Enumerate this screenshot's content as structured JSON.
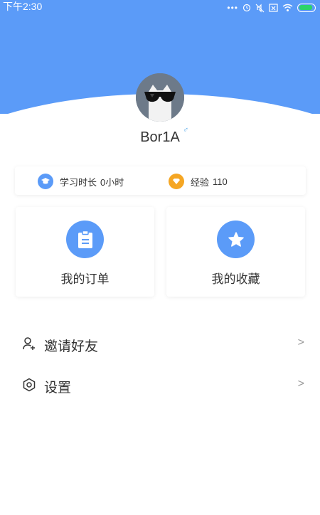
{
  "status_bar": {
    "time": "下午2:30",
    "icons": [
      "more-dots-icon",
      "alarm-icon",
      "mute-icon",
      "sim-icon",
      "wifi-icon",
      "battery-icon"
    ]
  },
  "profile": {
    "username": "Bor1A",
    "gender_symbol": "♂",
    "avatar_icon": "cat-with-sunglasses-avatar"
  },
  "stats": {
    "study_time_label": "学习时长",
    "study_time_value": "0小时",
    "experience_label": "经验",
    "experience_value": "110"
  },
  "cards": [
    {
      "label": "我的订单",
      "icon": "clipboard-icon"
    },
    {
      "label": "我的收藏",
      "icon": "star-icon"
    }
  ],
  "menu": [
    {
      "label": "邀请好友",
      "icon": "add-user-icon",
      "chevron": ">"
    },
    {
      "label": "设置",
      "icon": "hexagon-settings-icon",
      "chevron": ">"
    }
  ],
  "colors": {
    "primary": "#5b9bf8",
    "experience_badge": "#f5a623",
    "text": "#333333"
  }
}
